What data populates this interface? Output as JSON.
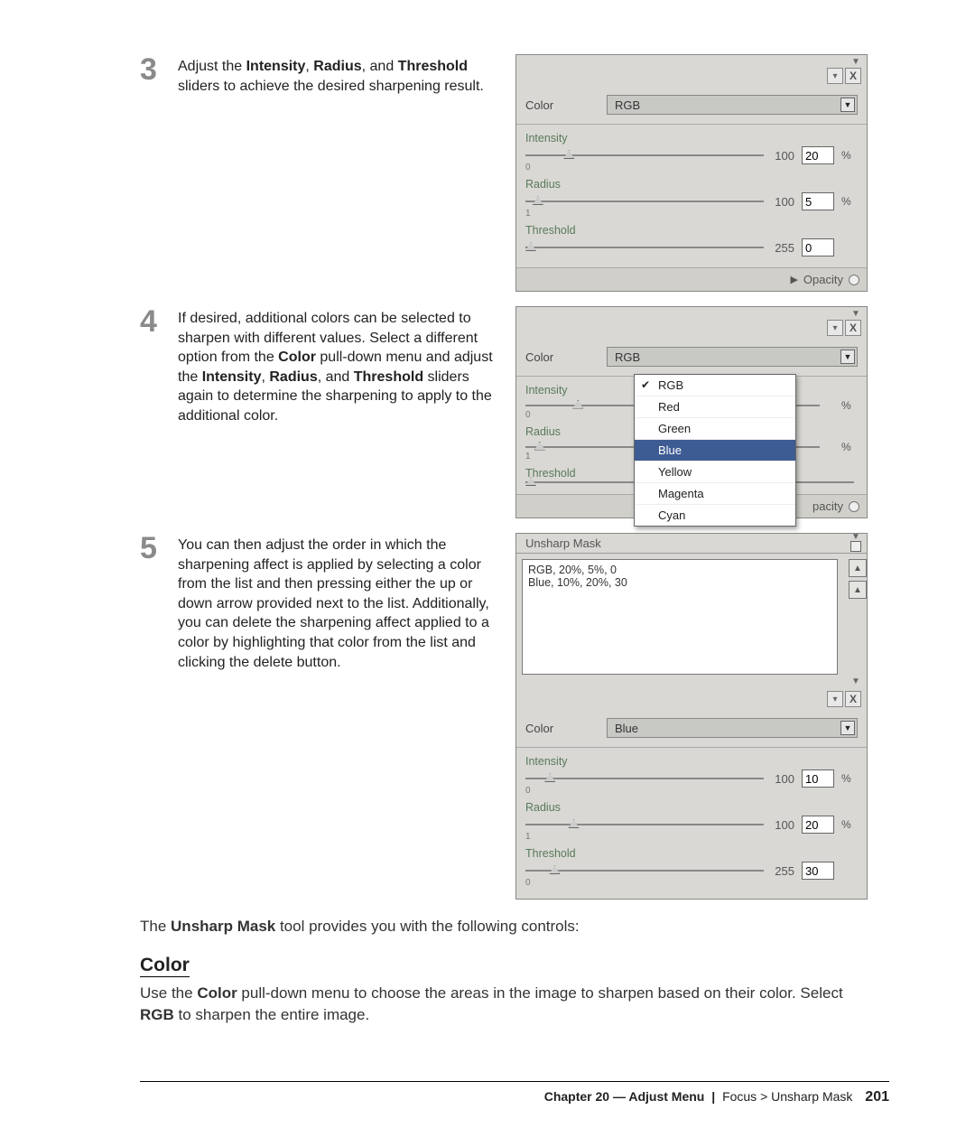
{
  "steps": {
    "s3": {
      "num": "3",
      "text_a": "Adjust the ",
      "b1": "Intensity",
      "sep1": ", ",
      "b2": "Radius",
      "sep2": ", and ",
      "b3": "Threshold",
      "text_b": " sliders to achieve the desired sharpening result."
    },
    "s4": {
      "num": "4",
      "text_a": "If desired, additional colors can be selected to sharpen with different values. Select a different option from the ",
      "b1": "Color",
      "text_b": " pull-down menu and adjust the ",
      "b2": "Intensity",
      "sep2": ", ",
      "b3": "Radius",
      "sep3": ", and ",
      "b4": "Threshold",
      "text_c": " sliders again to determine the sharpening to apply to the additional color."
    },
    "s5": {
      "num": "5",
      "text": "You can then adjust the order in which the sharpening affect is applied by selecting a color from the list and then pressing either the up or down arrow provided next to the list. Additionally, you can delete the sharpening affect applied to a color by highlighting that color from the list and clicking the delete button."
    }
  },
  "panel1": {
    "color_label": "Color",
    "color_value": "RGB",
    "intensity": {
      "label": "Intensity",
      "min": "0",
      "max": "100",
      "value": "20",
      "unit": "%"
    },
    "radius": {
      "label": "Radius",
      "min": "1",
      "max": "100",
      "value": "5",
      "unit": "%"
    },
    "threshold": {
      "label": "Threshold",
      "min": "",
      "max": "255",
      "value": "0",
      "unit": ""
    },
    "opacity": "Opacity"
  },
  "panel2": {
    "color_label": "Color",
    "color_value": "RGB",
    "intensity": {
      "label": "Intensity",
      "min": "0",
      "max": "",
      "value": "",
      "unit": "%"
    },
    "radius": {
      "label": "Radius",
      "min": "1",
      "max": "",
      "value": "",
      "unit": "%"
    },
    "threshold": {
      "label": "Threshold",
      "min": "",
      "max": "",
      "value": "",
      "unit": ""
    },
    "opacity": "pacity",
    "menu": [
      "RGB",
      "Red",
      "Green",
      "Blue",
      "Yellow",
      "Magenta",
      "Cyan"
    ],
    "menu_checked": 0,
    "menu_highlight": 3
  },
  "panel3": {
    "title": "Unsharp Mask",
    "list": [
      "RGB, 20%, 5%, 0",
      "Blue, 10%, 20%, 30"
    ],
    "color_label": "Color",
    "color_value": "Blue",
    "intensity": {
      "label": "Intensity",
      "min": "0",
      "max": "100",
      "value": "10",
      "unit": "%"
    },
    "radius": {
      "label": "Radius",
      "min": "1",
      "max": "100",
      "value": "20",
      "unit": "%"
    },
    "threshold": {
      "label": "Threshold",
      "min": "0",
      "max": "255",
      "value": "30",
      "unit": ""
    }
  },
  "after": {
    "line1a": "The ",
    "line1b": "Unsharp Mask",
    "line1c": " tool provides you with the following controls:",
    "head": "Color",
    "body_a": "Use the ",
    "body_b1": "Color",
    "body_b": " pull-down menu to choose the areas in the image to sharpen based on their color. Select ",
    "body_b2": "RGB",
    "body_c": " to sharpen the entire image."
  },
  "footer": {
    "chapter": "Chapter 20 — Adjust Menu",
    "sep": "|",
    "crumb": "Focus > Unsharp Mask",
    "page": "201"
  }
}
